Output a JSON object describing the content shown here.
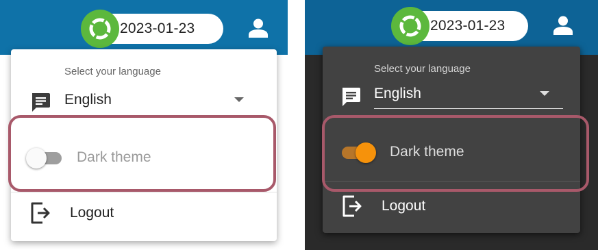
{
  "light_panel": {
    "date": "2023-01-23",
    "language_label": "Select your language",
    "language_value": "English",
    "dark_theme_label": "Dark theme",
    "dark_theme_enabled": false,
    "logout_label": "Logout"
  },
  "dark_panel": {
    "date": "2023-01-23",
    "language_label": "Select your language",
    "language_value": "English",
    "dark_theme_label": "Dark theme",
    "dark_theme_enabled": true,
    "logout_label": "Logout"
  },
  "icons": {
    "status": "status-ring-icon",
    "user": "account-icon",
    "language": "message-icon",
    "logout": "logout-icon"
  },
  "colors": {
    "light_topbar": "#0f72a8",
    "dark_topbar": "#0d6396",
    "status_green": "#5cb83d",
    "toggle_on": "#f6920b",
    "highlight_border": "#a8596a"
  }
}
